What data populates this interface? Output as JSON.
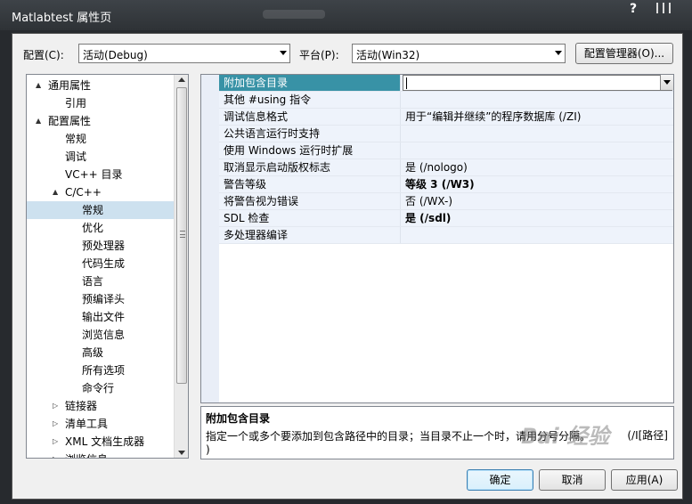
{
  "window": {
    "title": "Matlabtest 属性页",
    "help": "?"
  },
  "config": {
    "label": "配置(C):",
    "value": "活动(Debug)"
  },
  "platform": {
    "label": "平台(P):",
    "value": "活动(Win32)"
  },
  "config_manager": "配置管理器(O)...",
  "tree": [
    {
      "label": "通用属性",
      "expander": "▲",
      "level": 0
    },
    {
      "label": "引用",
      "level": 1
    },
    {
      "label": "配置属性",
      "expander": "▲",
      "level": 0
    },
    {
      "label": "常规",
      "level": 1
    },
    {
      "label": "调试",
      "level": 1
    },
    {
      "label": "VC++ 目录",
      "level": 1
    },
    {
      "label": "C/C++",
      "expander": "▲",
      "level": 1
    },
    {
      "label": "常规",
      "level": 2,
      "selected": true
    },
    {
      "label": "优化",
      "level": 2
    },
    {
      "label": "预处理器",
      "level": 2
    },
    {
      "label": "代码生成",
      "level": 2
    },
    {
      "label": "语言",
      "level": 2
    },
    {
      "label": "预编译头",
      "level": 2
    },
    {
      "label": "输出文件",
      "level": 2
    },
    {
      "label": "浏览信息",
      "level": 2
    },
    {
      "label": "高级",
      "level": 2
    },
    {
      "label": "所有选项",
      "level": 2
    },
    {
      "label": "命令行",
      "level": 2
    },
    {
      "label": "链接器",
      "expander": "▷",
      "level": 1
    },
    {
      "label": "清单工具",
      "expander": "▷",
      "level": 1
    },
    {
      "label": "XML 文档生成器",
      "expander": "▷",
      "level": 1
    },
    {
      "label": "浏览信息",
      "expander": "▷",
      "level": 1
    }
  ],
  "properties": [
    {
      "name": "附加包含目录",
      "value": "",
      "selected": true
    },
    {
      "name": "其他 #using 指令",
      "value": ""
    },
    {
      "name": "调试信息格式",
      "value": "用于“编辑并继续”的程序数据库 (/ZI)"
    },
    {
      "name": "公共语言运行时支持",
      "value": ""
    },
    {
      "name": "使用 Windows 运行时扩展",
      "value": ""
    },
    {
      "name": "取消显示启动版权标志",
      "value": "是 (/nologo)"
    },
    {
      "name": "警告等级",
      "value": "等级 3 (/W3)",
      "bold": true
    },
    {
      "name": "将警告视为错误",
      "value": "否 (/WX-)"
    },
    {
      "name": "SDL 检查",
      "value": "是 (/sdl)",
      "bold": true
    },
    {
      "name": "多处理器编译",
      "value": ""
    }
  ],
  "description": {
    "title": "附加包含目录",
    "text": "指定一个或多个要添加到包含路径中的目录；当目录不止一个时，请用分号分隔。",
    "tail": "(/I[路径]",
    "tail2": ")"
  },
  "buttons": {
    "ok": "确定",
    "cancel": "取消",
    "apply": "应用(A)"
  },
  "watermark": "Bai 经验"
}
